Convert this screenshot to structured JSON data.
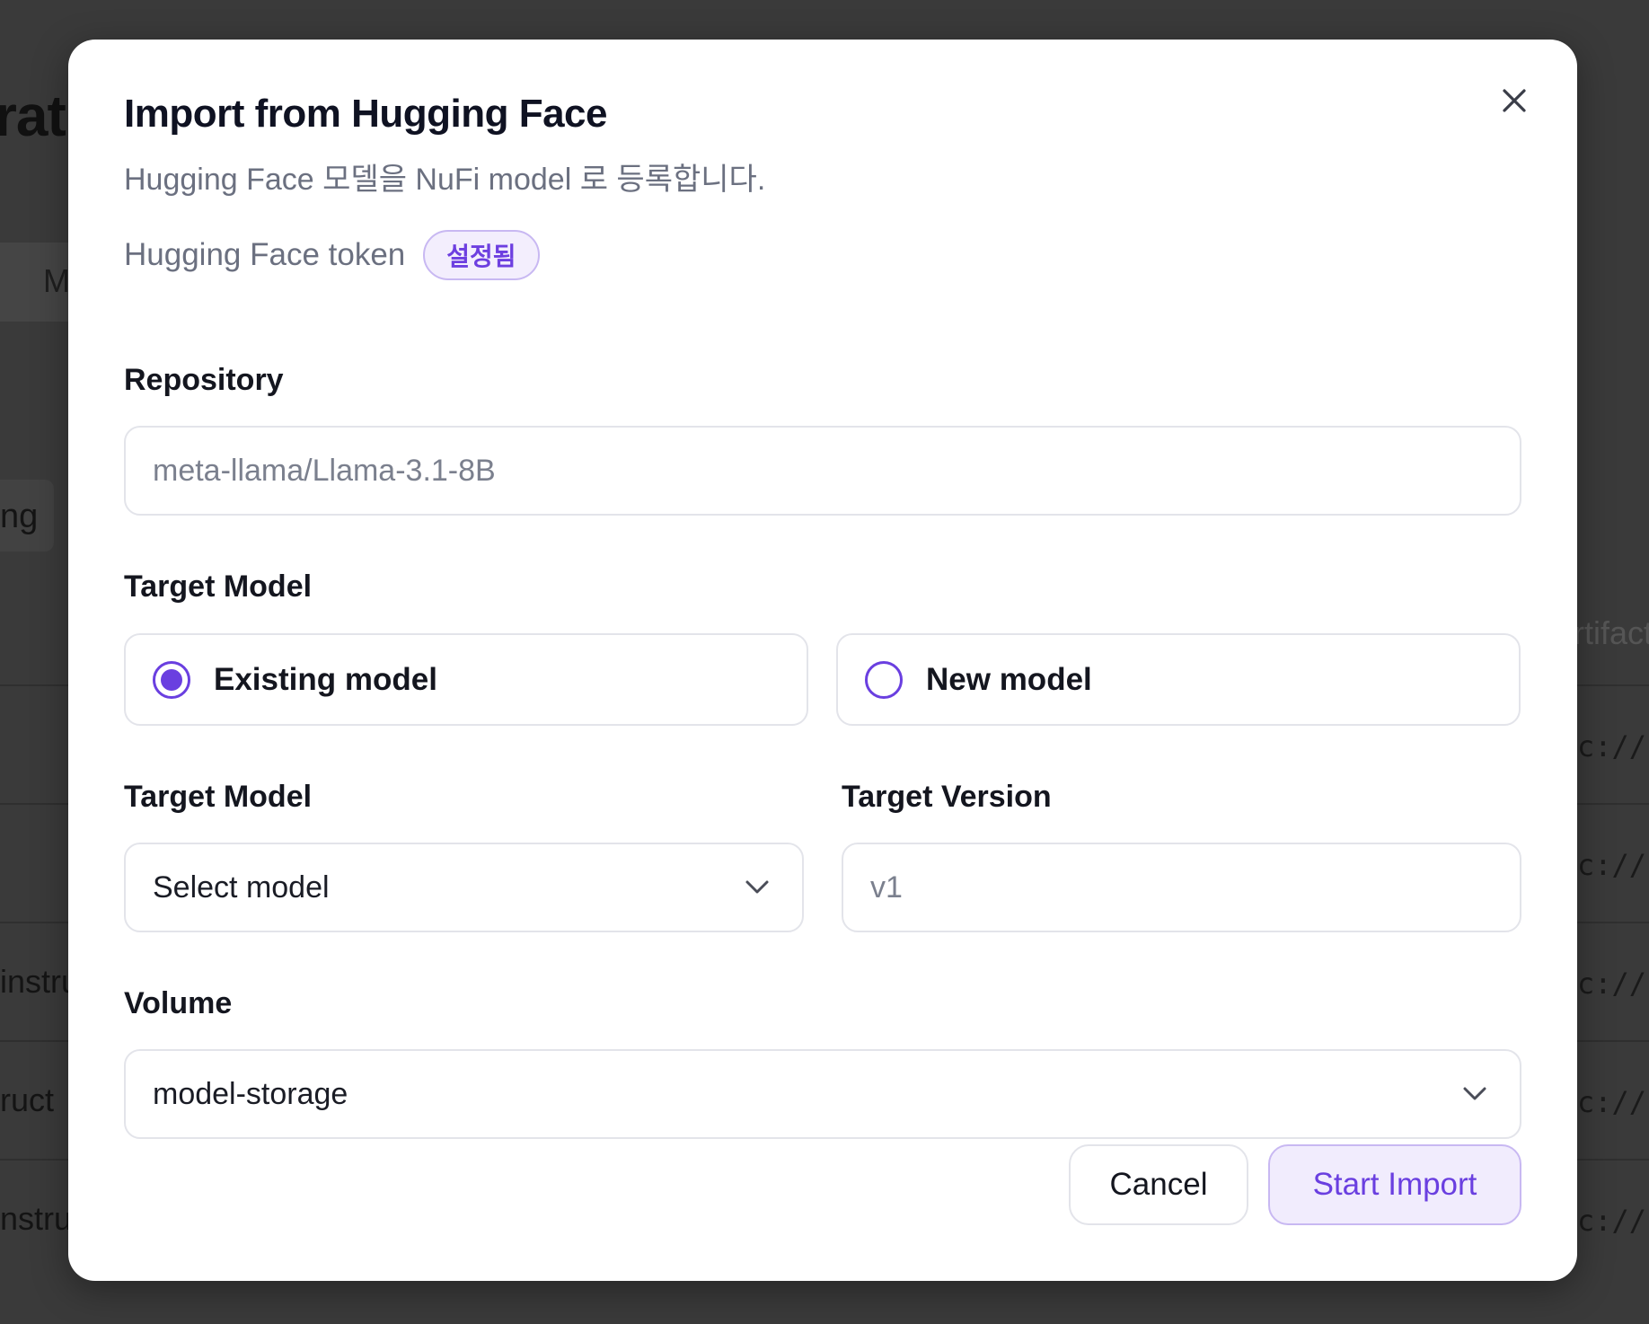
{
  "background": {
    "title_fragment": "rat",
    "chip_fragment": "M",
    "tab_fragment": "ng",
    "column_header_fragment": "rtifact",
    "rows": [
      {
        "left": "",
        "right": "c://r"
      },
      {
        "left": "",
        "right": "c://r"
      },
      {
        "left": "instru",
        "right": "c://r"
      },
      {
        "left": "ruct",
        "right": "c://r"
      },
      {
        "left": "nstru",
        "right": "c://r"
      }
    ]
  },
  "modal": {
    "title": "Import from Hugging Face",
    "subtitle": "Hugging Face 모델을 NuFi model 로 등록합니다.",
    "close_icon": "close-icon",
    "token": {
      "label": "Hugging Face token",
      "status_badge": "설정됨"
    },
    "repository": {
      "label": "Repository",
      "value": "",
      "placeholder": "meta-llama/Llama-3.1-8B"
    },
    "target_model_choice": {
      "label": "Target Model",
      "options": [
        {
          "label": "Existing model",
          "selected": true
        },
        {
          "label": "New model",
          "selected": false
        }
      ]
    },
    "target_model_select": {
      "label": "Target Model",
      "value": "Select model",
      "icon": "chevron-down-icon"
    },
    "target_version": {
      "label": "Target Version",
      "value": "",
      "placeholder": "v1"
    },
    "volume": {
      "label": "Volume",
      "value": "model-storage",
      "icon": "chevron-down-icon"
    },
    "buttons": {
      "cancel": "Cancel",
      "start_import": "Start Import"
    }
  },
  "colors": {
    "accent": "#6a3fe0",
    "accent_soft_bg": "#f1ecfd",
    "overlay": "#333333",
    "border": "#e3e4ea"
  }
}
